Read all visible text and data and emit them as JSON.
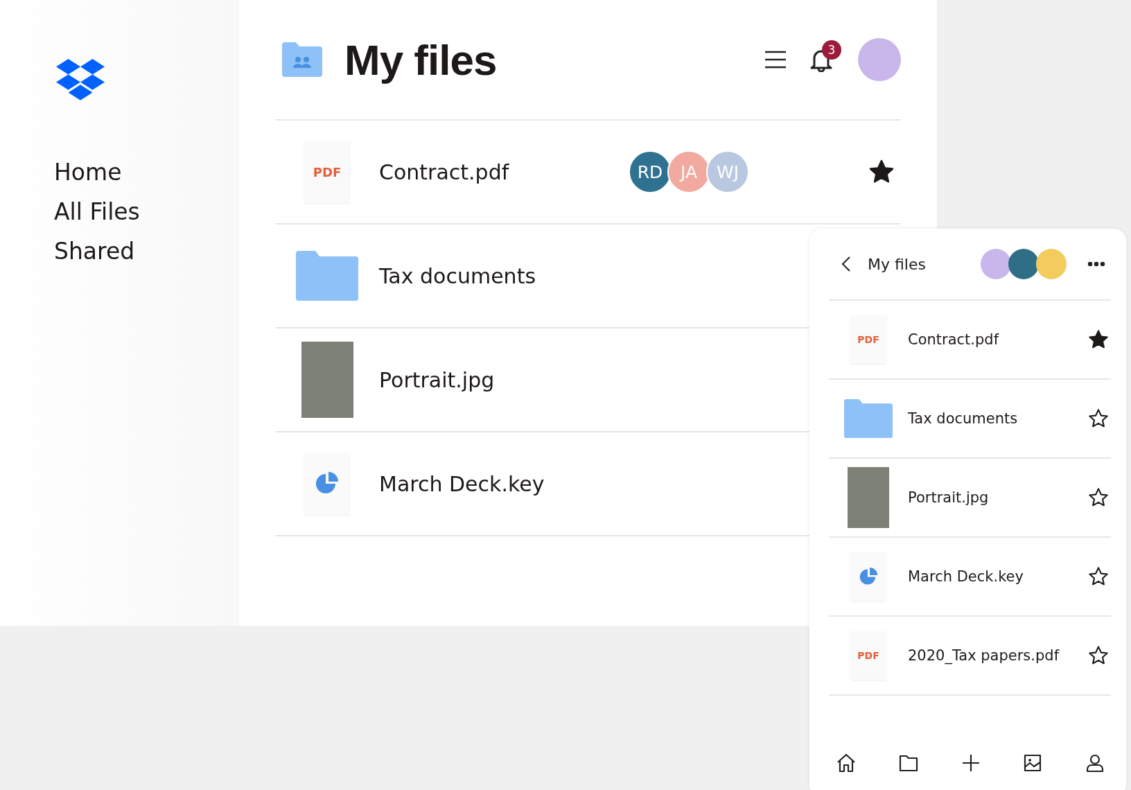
{
  "sidebar": {
    "items": [
      {
        "label": "Home"
      },
      {
        "label": "All Files"
      },
      {
        "label": "Shared"
      }
    ]
  },
  "header": {
    "title": "My files",
    "notification_count": "3"
  },
  "files": [
    {
      "kind": "pdf",
      "icon_text": "PDF",
      "name": "Contract.pdf",
      "collaborators": [
        {
          "initials": "RD",
          "color": "#2f7190"
        },
        {
          "initials": "JA",
          "color": "#f2aaa0"
        },
        {
          "initials": "WJ",
          "color": "#b9c7e0"
        }
      ],
      "starred": true
    },
    {
      "kind": "folder",
      "name": "Tax documents"
    },
    {
      "kind": "photo",
      "name": "Portrait.jpg"
    },
    {
      "kind": "keynote",
      "name": "March Deck.key"
    }
  ],
  "mobile": {
    "title": "My files",
    "members": [
      {
        "color": "#c9b6ea"
      },
      {
        "color": "#2f6f86"
      },
      {
        "color": "#f4cc5e"
      }
    ],
    "files": [
      {
        "kind": "pdf",
        "icon_text": "PDF",
        "name": "Contract.pdf",
        "starred": true
      },
      {
        "kind": "folder",
        "name": "Tax documents",
        "starred": false
      },
      {
        "kind": "photo",
        "name": "Portrait.jpg",
        "starred": false
      },
      {
        "kind": "keynote",
        "name": "March Deck.key",
        "starred": false
      },
      {
        "kind": "pdf",
        "icon_text": "PDF",
        "name": "2020_Tax papers.pdf",
        "starred": false
      }
    ],
    "nav": [
      {
        "kind": "home"
      },
      {
        "kind": "folder"
      },
      {
        "kind": "add"
      },
      {
        "kind": "photos"
      },
      {
        "kind": "account"
      }
    ]
  }
}
